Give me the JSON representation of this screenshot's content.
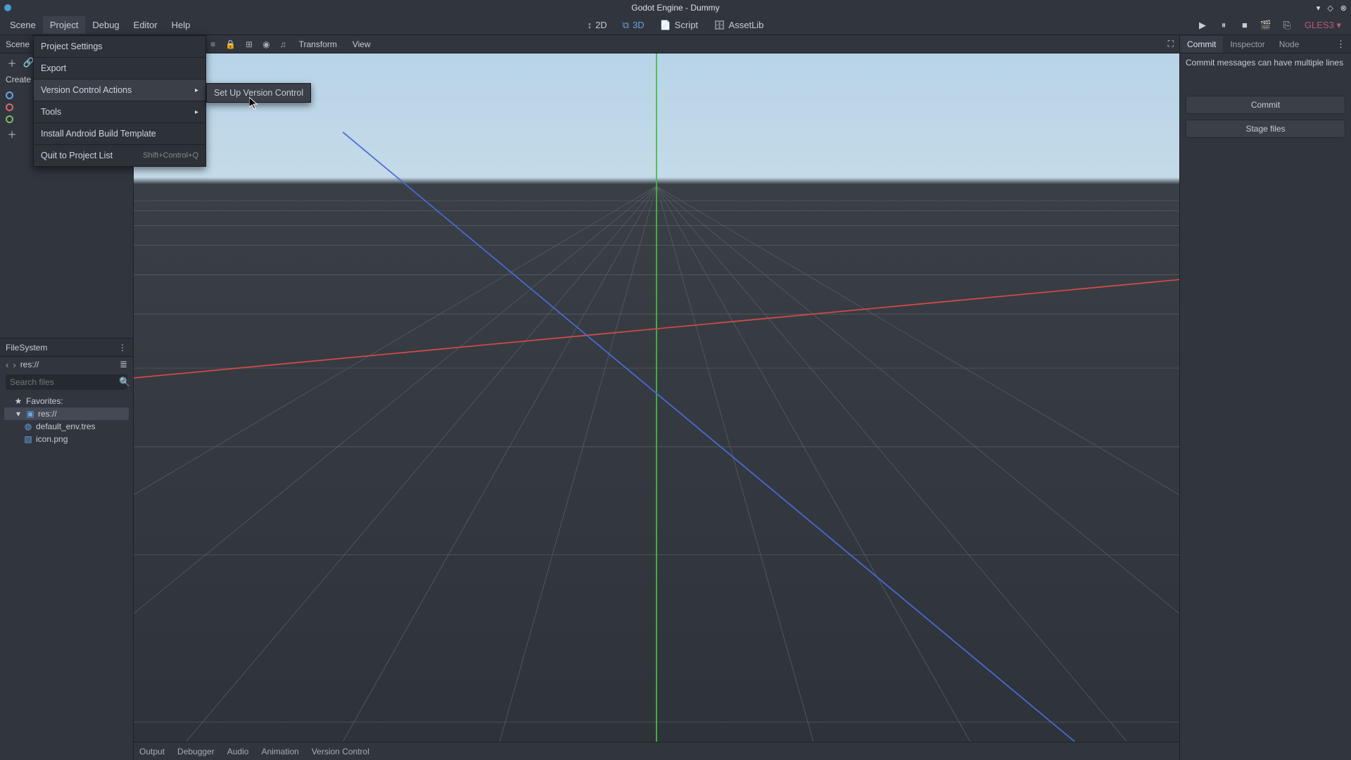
{
  "title": "Godot Engine - Dummy",
  "menubar": {
    "items": [
      "Scene",
      "Project",
      "Debug",
      "Editor",
      "Help"
    ],
    "active_index": 1
  },
  "modes": {
    "items": [
      "2D",
      "3D",
      "Script",
      "AssetLib"
    ],
    "active_index": 1
  },
  "renderer": "GLES3",
  "project_menu": {
    "project_settings": "Project Settings",
    "export": "Export",
    "version_control": "Version Control Actions",
    "tools": "Tools",
    "install_android": "Install Android Build Template",
    "quit": "Quit to Project List",
    "quit_shortcut": "Shift+Control+Q"
  },
  "submenu": {
    "setup_vcs": "Set Up Version Control"
  },
  "scene_panel": {
    "title": "Scene",
    "create_label": "Create"
  },
  "filesystem": {
    "title": "FileSystem",
    "path": "res://",
    "search_placeholder": "Search files",
    "favorites": "Favorites:",
    "root": "res://",
    "files": [
      "default_env.tres",
      "icon.png"
    ]
  },
  "viewport_toolbar": {
    "transform": "Transform",
    "view": "View"
  },
  "bottom_tabs": [
    "Output",
    "Debugger",
    "Audio",
    "Animation",
    "Version Control"
  ],
  "right_tabs": {
    "items": [
      "Commit",
      "Inspector",
      "Node"
    ],
    "active_index": 0
  },
  "commit": {
    "placeholder": "Commit messages can have multiple lines",
    "commit_btn": "Commit",
    "stage_btn": "Stage files"
  }
}
